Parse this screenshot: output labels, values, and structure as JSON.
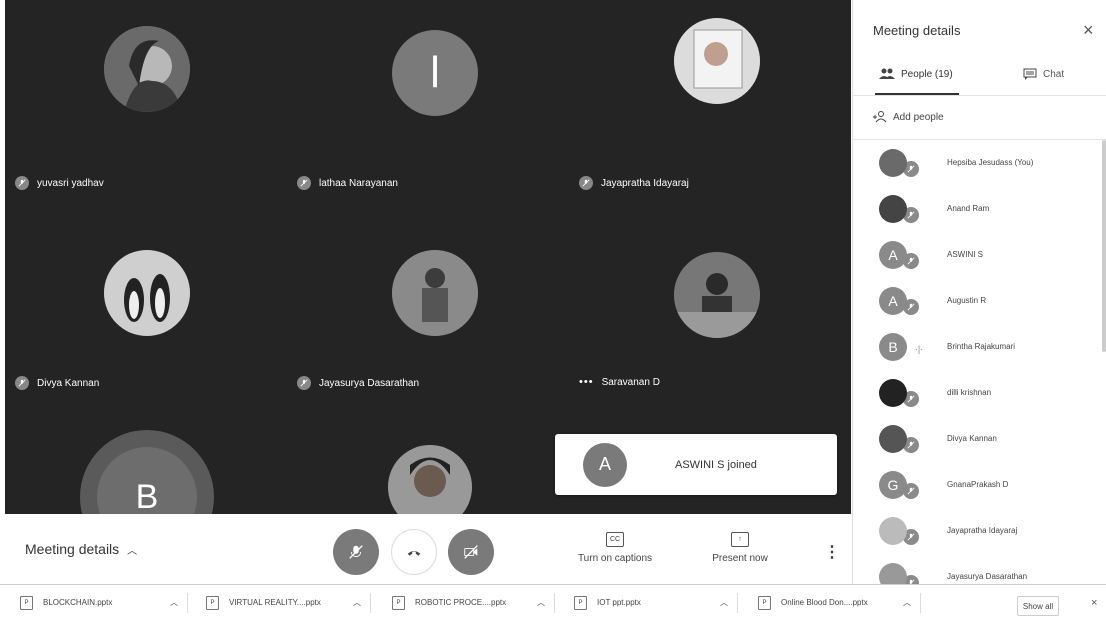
{
  "tiles": [
    {
      "name": "yuvasri yadhav",
      "status": "muted"
    },
    {
      "name": "lathaa Narayanan",
      "status": "muted",
      "letter": "l"
    },
    {
      "name": "Jayapratha Idayaraj",
      "status": "muted"
    },
    {
      "name": "Divya Kannan",
      "status": "muted"
    },
    {
      "name": "Jayasurya Dasarathan",
      "status": "muted"
    },
    {
      "name": "Saravanan D",
      "status": "speaking",
      "dots": "•••"
    }
  ],
  "big_tile": {
    "letter": "B"
  },
  "toast": {
    "avatar": "A",
    "text": "ASWINI S joined"
  },
  "controls": {
    "meeting_details": "Meeting details",
    "captions": "Turn on captions",
    "captions_icon": "CC",
    "present": "Present now",
    "more": "⋮"
  },
  "panel": {
    "title": "Meeting details",
    "close": "×",
    "people_tab": "People (19)",
    "chat_tab": "Chat",
    "add_people": "Add people",
    "participants": [
      {
        "name": "Hepsiba Jesudass (You)",
        "avatar": "",
        "status": "muted"
      },
      {
        "name": "Anand Ram",
        "avatar": "",
        "status": "muted"
      },
      {
        "name": "ASWINI S",
        "avatar": "A",
        "status": "muted"
      },
      {
        "name": "Augustin R",
        "avatar": "A",
        "status": "muted"
      },
      {
        "name": "Brintha Rajakumari",
        "avatar": "B",
        "status": "speaking"
      },
      {
        "name": "dilli krishnan",
        "avatar": "",
        "status": "muted"
      },
      {
        "name": "Divya Kannan",
        "avatar": "",
        "status": "muted"
      },
      {
        "name": "GnanaPrakash D",
        "avatar": "G",
        "status": "muted"
      },
      {
        "name": "Jayapratha Idayaraj",
        "avatar": "",
        "status": "muted"
      },
      {
        "name": "Jayasurya Dasarathan",
        "avatar": "",
        "status": "muted"
      }
    ]
  },
  "downloads": {
    "items": [
      "BLOCKCHAIN.pptx",
      "VIRTUAL REALITY....pptx",
      "ROBOTIC PROCE....pptx",
      "IOT ppt.pptx",
      "Online Blood Don....pptx"
    ],
    "show_all": "Show all",
    "close": "×"
  }
}
